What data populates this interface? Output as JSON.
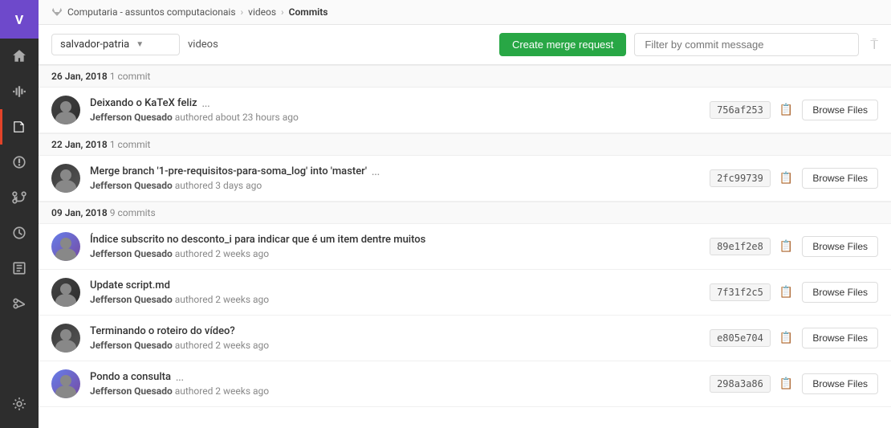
{
  "sidebar": {
    "avatar_label": "V",
    "items": [
      {
        "name": "home",
        "icon": "home",
        "active": false
      },
      {
        "name": "activity",
        "icon": "activity",
        "active": false
      },
      {
        "name": "repository",
        "icon": "repository",
        "active": true
      },
      {
        "name": "issues",
        "icon": "issues",
        "active": false
      },
      {
        "name": "merge-requests",
        "icon": "merge-requests",
        "active": false
      },
      {
        "name": "history",
        "icon": "history",
        "active": false
      },
      {
        "name": "snippets",
        "icon": "snippets",
        "active": false
      },
      {
        "name": "scissors",
        "icon": "scissors",
        "active": false
      },
      {
        "name": "settings",
        "icon": "settings",
        "active": false
      }
    ]
  },
  "breadcrumb": {
    "parts": [
      {
        "label": "Computaria - assuntos computacionais",
        "link": true
      },
      {
        "label": "videos",
        "link": true
      },
      {
        "label": "Commits",
        "link": false
      }
    ]
  },
  "toolbar": {
    "branch_name": "salvador-patria",
    "repo_label": "videos",
    "create_merge_label": "Create merge request",
    "filter_placeholder": "Filter by commit message",
    "rss_title": "RSS feed"
  },
  "commit_groups": [
    {
      "date": "26 Jan, 2018",
      "count": "1 commit",
      "commits": [
        {
          "message": "Deixando o KaTeX feliz",
          "has_ellipsis": true,
          "author": "Jefferson Quesado",
          "time": "about 23 hours ago",
          "hash": "756af253",
          "browse_label": "Browse Files"
        }
      ]
    },
    {
      "date": "22 Jan, 2018",
      "count": "1 commit",
      "commits": [
        {
          "message": "Merge branch '1-pre-requisitos-para-soma_log' into 'master'",
          "has_ellipsis": true,
          "author": "Jefferson Quesado",
          "time": "3 days ago",
          "hash": "2fc99739",
          "browse_label": "Browse Files"
        }
      ]
    },
    {
      "date": "09 Jan, 2018",
      "count": "9 commits",
      "commits": [
        {
          "message": "Índice subscrito no desconto_i para indicar que é um item dentre muitos",
          "has_ellipsis": false,
          "author": "Jefferson Quesado",
          "time": "2 weeks ago",
          "hash": "89e1f2e8",
          "browse_label": "Browse Files"
        },
        {
          "message": "Update script.md",
          "has_ellipsis": false,
          "author": "Jefferson Quesado",
          "time": "2 weeks ago",
          "hash": "7f31f2c5",
          "browse_label": "Browse Files"
        },
        {
          "message": "Terminando o roteiro do vídeo?",
          "has_ellipsis": false,
          "author": "Jefferson Quesado",
          "time": "2 weeks ago",
          "hash": "e805e704",
          "browse_label": "Browse Files"
        },
        {
          "message": "Pondo a consulta",
          "has_ellipsis": true,
          "author": "Jefferson Quesado",
          "time": "2 weeks ago",
          "hash": "298a3a86",
          "browse_label": "Browse Files"
        }
      ]
    }
  ],
  "colors": {
    "create_merge_bg": "#28a745",
    "active_sidebar_indicator": "#e24329"
  }
}
